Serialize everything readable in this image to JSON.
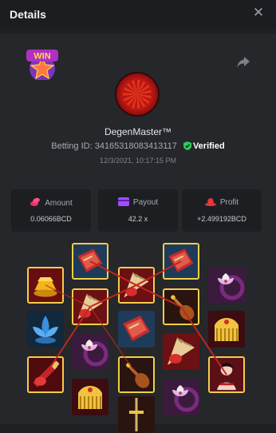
{
  "header": {
    "title": "Details",
    "close_icon": "close-icon"
  },
  "brand": {
    "badge_text": "WIN"
  },
  "user": {
    "name": "DegenMaster™",
    "betting_id_label": "Betting ID:",
    "betting_id": "34165318083413117",
    "verified_label": "Verified",
    "timestamp": "12/3/2021, 10:17:15 PM"
  },
  "stats": {
    "amount": {
      "label": "Amount",
      "value": "0.06066BCD",
      "icon": "coins-icon",
      "color": "#e8356a"
    },
    "payout": {
      "label": "Payout",
      "value": "42.2 x",
      "icon": "wallet-icon",
      "color": "#a24dff"
    },
    "profit": {
      "label": "Profit",
      "value": "+2.499192BCD",
      "icon": "hat-icon",
      "color": "#e8363a"
    }
  },
  "reels": [
    [
      "gold-ingots",
      "lotus",
      "red-fan"
    ],
    [
      "book",
      "fan",
      "orchid",
      "golden-comb"
    ],
    [
      "fan",
      "book",
      "pipa-lute",
      "sword"
    ],
    [
      "book",
      "pipa-lute",
      "fan",
      "orchid"
    ],
    [
      "orchid",
      "golden-comb",
      "lady"
    ]
  ],
  "winning_positions": [
    [
      0,
      0
    ],
    [
      0,
      2
    ],
    [
      1,
      0
    ],
    [
      1,
      1
    ],
    [
      2,
      0
    ],
    [
      2,
      2
    ],
    [
      3,
      0
    ],
    [
      3,
      1
    ],
    [
      4,
      2
    ]
  ],
  "colors": {
    "highlight": "#f0cf4a",
    "payline": "#c0261f"
  }
}
